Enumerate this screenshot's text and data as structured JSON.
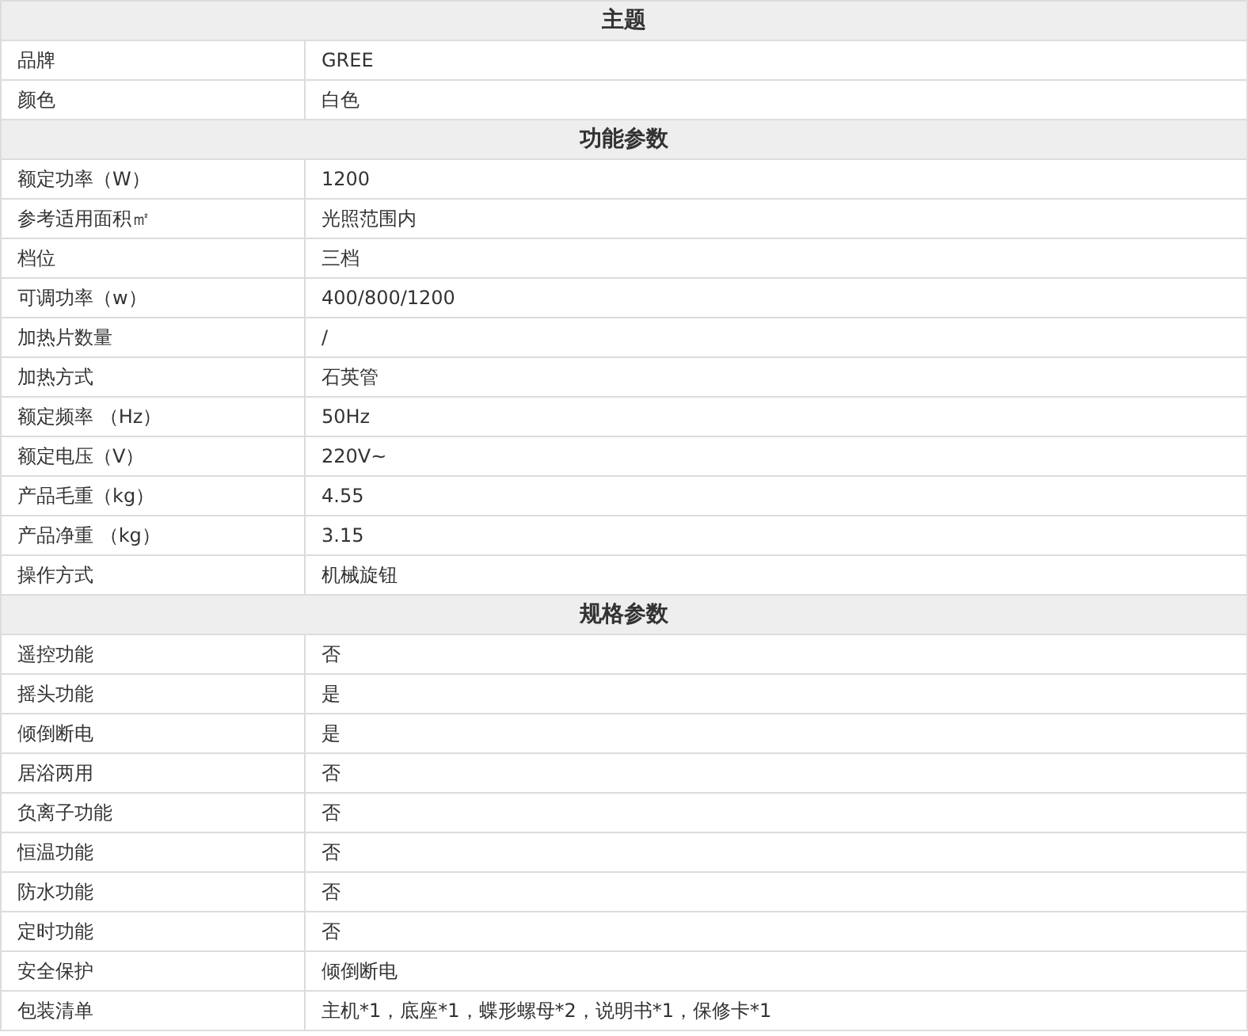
{
  "sections": [
    {
      "title": "主题",
      "rows": [
        {
          "label": "品牌",
          "value": "GREE"
        },
        {
          "label": "颜色",
          "value": "白色"
        }
      ]
    },
    {
      "title": "功能参数",
      "rows": [
        {
          "label": "额定功率（W）",
          "value": "1200"
        },
        {
          "label": "参考适用面积㎡",
          "value": "光照范围内"
        },
        {
          "label": "档位",
          "value": "三档"
        },
        {
          "label": "可调功率（w）",
          "value": "400/800/1200"
        },
        {
          "label": "加热片数量",
          "value": "/"
        },
        {
          "label": "加热方式",
          "value": "石英管"
        },
        {
          "label": "额定频率 （Hz）",
          "value": "50Hz"
        },
        {
          "label": "额定电压（V）",
          "value": "220V~"
        },
        {
          "label": "产品毛重（kg）",
          "value": "4.55"
        },
        {
          "label": "产品净重 （kg）",
          "value": "3.15"
        },
        {
          "label": "操作方式",
          "value": "机械旋钮"
        }
      ]
    },
    {
      "title": "规格参数",
      "rows": [
        {
          "label": "遥控功能",
          "value": "否"
        },
        {
          "label": "摇头功能",
          "value": "是"
        },
        {
          "label": "倾倒断电",
          "value": "是"
        },
        {
          "label": "居浴两用",
          "value": "否"
        },
        {
          "label": "负离子功能",
          "value": "否"
        },
        {
          "label": "恒温功能",
          "value": "否"
        },
        {
          "label": "防水功能",
          "value": "否"
        },
        {
          "label": "定时功能",
          "value": "否"
        },
        {
          "label": "安全保护",
          "value": "倾倒断电"
        },
        {
          "label": "包装清单",
          "value": "主机*1，底座*1，蝶形螺母*2，说明书*1，保修卡*1"
        }
      ]
    }
  ]
}
